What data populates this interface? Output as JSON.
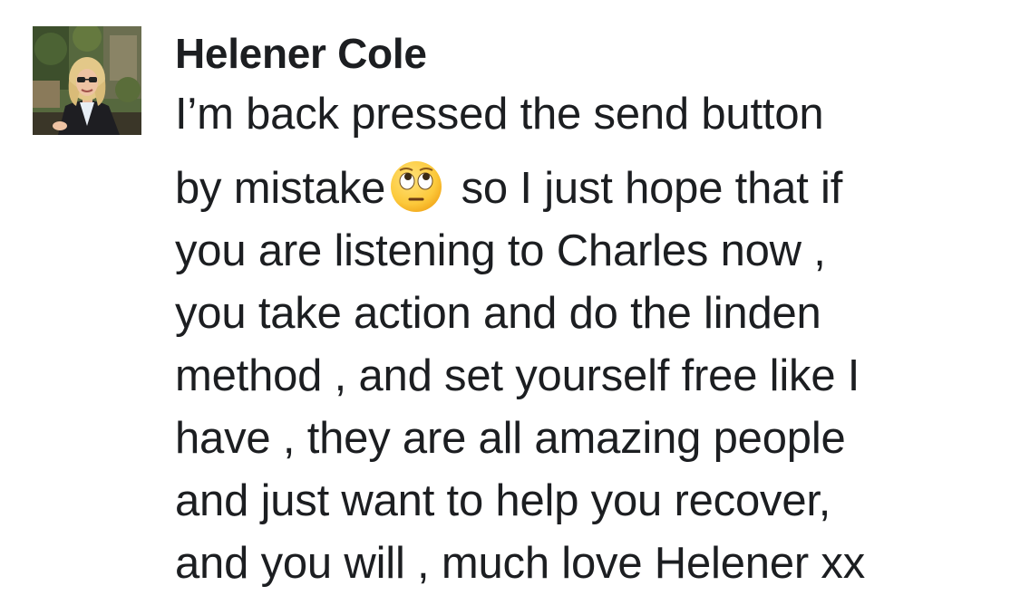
{
  "comment": {
    "author": "Helener Cole",
    "avatar_icon": "profile-photo",
    "emoji_icon": "face-with-rolling-eyes-emoji",
    "lines": [
      "I’m back pressed the send button",
      "by mistake",
      "so I just hope that if",
      "you are listening to Charles now ,",
      "you take action and do the linden",
      "method , and set yourself free like I",
      "have , they are all amazing people",
      "and just want to help you recover,",
      "and you will , much love Helener xx"
    ]
  }
}
